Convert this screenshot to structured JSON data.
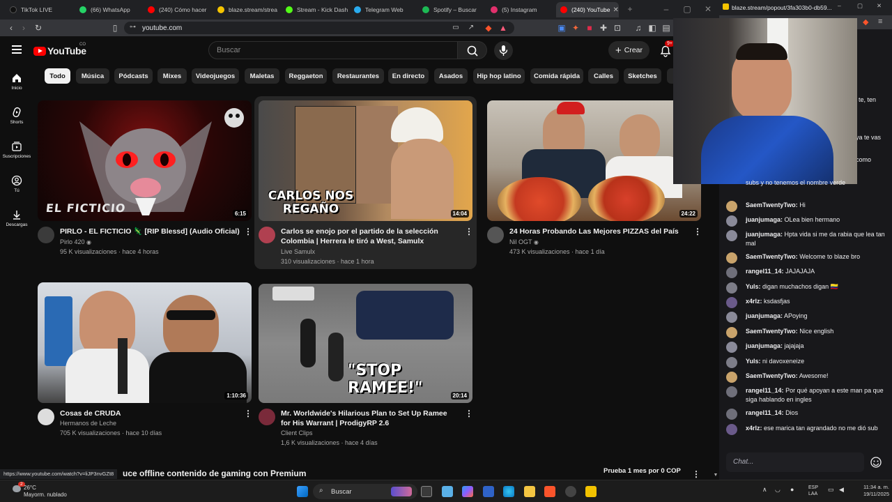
{
  "browser": {
    "tabs": [
      {
        "label": "TikTok LIVE",
        "color": "#111111"
      },
      {
        "label": "(66) WhatsApp",
        "color": "#25d366"
      },
      {
        "label": "(240) Cómo hacer",
        "color": "#ff0000"
      },
      {
        "label": "blaze.stream/strea",
        "color": "#f5c400"
      },
      {
        "label": "Stream - Kick Dash",
        "color": "#53fc18"
      },
      {
        "label": "Telegram Web",
        "color": "#2aabee"
      },
      {
        "label": "Spotify – Buscar",
        "color": "#1db954"
      },
      {
        "label": "(5) Instagram",
        "color": "#e1306c"
      },
      {
        "label": "(240) YouTube",
        "color": "#ff0000"
      }
    ],
    "url": "youtube.com",
    "status_url": "https://www.youtube.com/watch?v=liJP3nvGZt8"
  },
  "youtube": {
    "logo_text": "YouTube",
    "logo_country": "CO",
    "search_placeholder": "Buscar",
    "create_label": "Crear",
    "notif_badge": "9+",
    "rail": [
      {
        "label": "Inicio",
        "icon": "home-icon"
      },
      {
        "label": "Shorts",
        "icon": "shorts-icon"
      },
      {
        "label": "Suscripciones",
        "icon": "subscriptions-icon"
      },
      {
        "label": "Tú",
        "icon": "you-icon"
      },
      {
        "label": "Descargas",
        "icon": "download-icon"
      }
    ],
    "chips": [
      "Todo",
      "Música",
      "Pódcasts",
      "Mixes",
      "Videojuegos",
      "Maletas",
      "Reggaeton",
      "Restaurantes",
      "En directo",
      "Asados",
      "Hip hop latino",
      "Comida rápida",
      "Calles",
      "Sketches"
    ],
    "videos": [
      {
        "title": "PIRLO - EL FICTICIO 🦎 [RIP Blessd] (Audio Oficial)",
        "channel": "Pirlo 420",
        "meta": "95 K visualizaciones · hace 4 horas",
        "duration": "6:15",
        "thumb_text": "EL FICTICIO"
      },
      {
        "title": "Carlos se enojo por el partido de la selección Colombia | Herrera le tiró a West, Samulx",
        "channel": "Live Samulx",
        "meta": "310 visualizaciones · hace 1 hora",
        "duration": "14:04",
        "thumb_text": "CARLOS NOS REGAÑO"
      },
      {
        "title": "24 Horas Probando Las Mejores PIZZAS del País",
        "channel": "Nil OGT",
        "meta": "473 K visualizaciones · hace 1 día",
        "duration": "24:22",
        "thumb_text": ""
      },
      {
        "title": "Cosas de CRUDA",
        "channel": "Hermanos de Leche",
        "meta": "705 K visualizaciones · hace 10 días",
        "duration": "1:10:36",
        "thumb_text": ""
      },
      {
        "title": "Mr. Worldwide's Hilarious Plan to Set Up Ramee for His Warrant | ProdigyRP 2.6",
        "channel": "Client Clips",
        "meta": "1,6 K visualizaciones · hace 4 días",
        "duration": "20:14",
        "thumb_text": "\"STOP RAMEE!\""
      }
    ],
    "premium_banner": "uce offline contenido de gaming con Premium",
    "trial_label": "Prueba 1 mes por 0 COP"
  },
  "chat": {
    "window_title": "blaze.stream/popout/3fa303b0-db59...",
    "partial_right": [
      "te, ten",
      "ya te vas",
      "como"
    ],
    "messages": [
      {
        "user": "",
        "text": "subs y no tenemos el nombre verde",
        "color": "#efeff1"
      },
      {
        "user": "SaemTwentyTwo:",
        "text": "Hi",
        "color": "#c9a36b"
      },
      {
        "user": "juanjumaga:",
        "text": "OLea bien hermano",
        "color": "#8a8a99"
      },
      {
        "user": "juanjumaga:",
        "text": "Hpta vida si me da rabia que lea tan mal",
        "color": "#8a8a99"
      },
      {
        "user": "SaemTwentyTwo:",
        "text": "Welcome to blaze bro",
        "color": "#c9a36b"
      },
      {
        "user": "rangel11_14:",
        "text": "JAJAJAJA",
        "color": "#6f6f7a"
      },
      {
        "user": "Yuls:",
        "text": "digan muchachos digan 🇨🇴",
        "color": "#7d7d88"
      },
      {
        "user": "x4rlz:",
        "text": "ksdasfjas",
        "color": "#6a5a8a"
      },
      {
        "user": "juanjumaga:",
        "text": "APoying",
        "color": "#8a8a99"
      },
      {
        "user": "SaemTwentyTwo:",
        "text": "Nice english",
        "color": "#c9a36b"
      },
      {
        "user": "juanjumaga:",
        "text": "jajajaja",
        "color": "#8a8a99"
      },
      {
        "user": "Yuls:",
        "text": "ni davoxeneize",
        "color": "#7d7d88"
      },
      {
        "user": "SaemTwentyTwo:",
        "text": "Awesome!",
        "color": "#c9a36b"
      },
      {
        "user": "rangel11_14:",
        "text": "Por qué apoyan a este man pa que siga hablando en ingles",
        "color": "#6f6f7a"
      },
      {
        "user": "rangel11_14:",
        "text": "Dios",
        "color": "#6f6f7a"
      },
      {
        "user": "x4rlz:",
        "text": "ese marica tan agrandado no me dió sub",
        "color": "#6a5a8a"
      }
    ],
    "input_placeholder": "Chat..."
  },
  "taskbar": {
    "temp": "26°C",
    "weather": "Mayorm. nublado",
    "search_label": "Buscar",
    "lang_top": "ESP",
    "lang_bottom": "LAA",
    "time": "11:34 a. m.",
    "date": "19/11/2025",
    "weather_badge": "2"
  }
}
